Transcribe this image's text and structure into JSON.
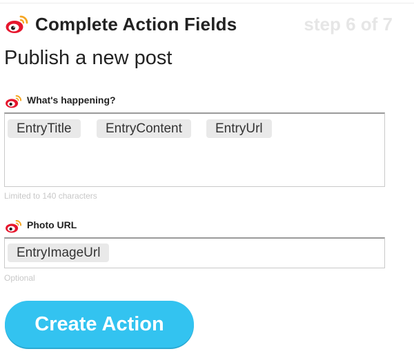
{
  "header": {
    "title": "Complete Action Fields",
    "step": "step 6 of 7",
    "icon": "weibo-icon"
  },
  "subtitle": "Publish a new post",
  "fields": [
    {
      "label": "What's happening?",
      "icon": "weibo-icon",
      "tokens": [
        "EntryTitle",
        "EntryContent",
        "EntryUrl"
      ],
      "hint": "Limited to 140 characters"
    },
    {
      "label": "Photo URL",
      "icon": "weibo-icon",
      "tokens": [
        "EntryImageUrl"
      ],
      "hint": "Optional"
    }
  ],
  "cta": {
    "label": "Create Action",
    "color": "#33c3f0"
  },
  "colors": {
    "brand_red": "#e6162d",
    "brand_orange": "#f5a623"
  }
}
